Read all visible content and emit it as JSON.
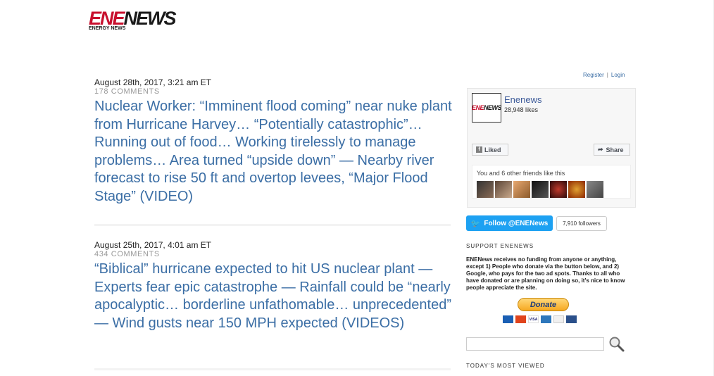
{
  "logo": {
    "ene": "ENE",
    "news": "NEWS",
    "sub": "ENERGY NEWS"
  },
  "posts": [
    {
      "date": "August 28th, 2017, 3:21 am ET",
      "comments": "178 COMMENTS",
      "title": "Nuclear Worker: “Imminent flood coming” near nuke plant from Hurricane Harvey… “Potentially catastrophic”… Running out of food… Working tirelessly to manage problems… Area turned “upside down” — Nearby river forecast to rise 50 ft and overtop levees, “Major Flood Stage” (VIDEO)"
    },
    {
      "date": "August 25th, 2017, 4:01 am ET",
      "comments": "434 COMMENTS",
      "title": "“Biblical” hurricane expected to hit US nuclear plant — Experts fear epic catastrophe — Rainfall could be “nearly apocalyptic… borderline unfathomable… unprecedented” — Wind gusts near 150 MPH expected (VIDEOS)"
    }
  ],
  "auth": {
    "register": "Register",
    "separator": "|",
    "login": "Login"
  },
  "facebook": {
    "page_name": "Enenews",
    "likes": "28,948 likes",
    "liked_label": "Liked",
    "share_label": "Share",
    "friends_text": "You and 6 other friends like this",
    "thumb_ene": "ENE",
    "thumb_news": "NEWS"
  },
  "twitter": {
    "follow_label": "Follow @ENENews",
    "followers": "7,910 followers"
  },
  "support": {
    "heading": "SUPPORT ENENEWS",
    "text": "ENENews receives no funding from anyone or anything, except 1) People who donate via the button below, and 2) Google, who pays for the two ad spots. Thanks to all who have donated or are planning on doing so, it's nice to know people appreciate the site.",
    "donate_label": "Donate"
  },
  "search": {
    "placeholder": ""
  },
  "todays_most_viewed": "TODAY'S MOST VIEWED",
  "colors": {
    "link": "#3b6ea5",
    "brand_red": "#c8102e",
    "twitter": "#1da1f2"
  }
}
